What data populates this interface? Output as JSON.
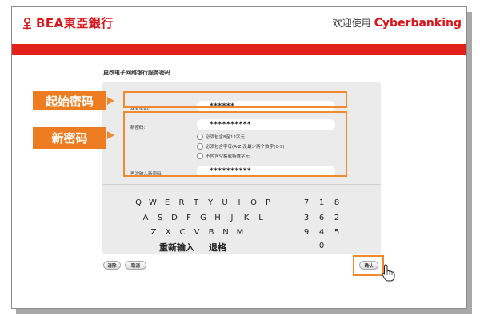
{
  "header": {
    "logo_text": "BEA東亞銀行",
    "welcome_text": "欢迎使用",
    "brand_text": "Cyberbanking"
  },
  "page": {
    "title": "更改电子网络银行服务密码"
  },
  "form": {
    "current_label": "现有密码:",
    "current_value": "******",
    "new_label": "新密码:",
    "new_value": "**********",
    "rules": [
      "必须包含8至12字元",
      "必须包含字母(A-Z)及最少两个数字(0-9)",
      "不包含空格或特殊字元"
    ],
    "confirm_label": "再次输入新密码",
    "confirm_value": "**********"
  },
  "annotations": {
    "initial_password": "起始密码",
    "new_password": "新密码"
  },
  "keyboard": {
    "row1": [
      "Q",
      "W",
      "E",
      "R",
      "T",
      "Y",
      "U",
      "I",
      "O",
      "P"
    ],
    "row2": [
      "A",
      "S",
      "D",
      "F",
      "G",
      "H",
      "J",
      "K",
      "L"
    ],
    "row3": [
      "Z",
      "X",
      "C",
      "V",
      "B",
      "N",
      "M"
    ],
    "reenter_label": "重新输入",
    "backspace_label": "退格",
    "numpad": [
      [
        "7",
        "1",
        "8"
      ],
      [
        "3",
        "6",
        "2"
      ],
      [
        "9",
        "4",
        "5"
      ],
      [
        "0"
      ]
    ]
  },
  "buttons": {
    "clear": "清除",
    "cancel": "取消",
    "confirm": "确认"
  },
  "colors": {
    "brand_red": "#d6171c",
    "highlight_orange": "#ee7d22"
  }
}
